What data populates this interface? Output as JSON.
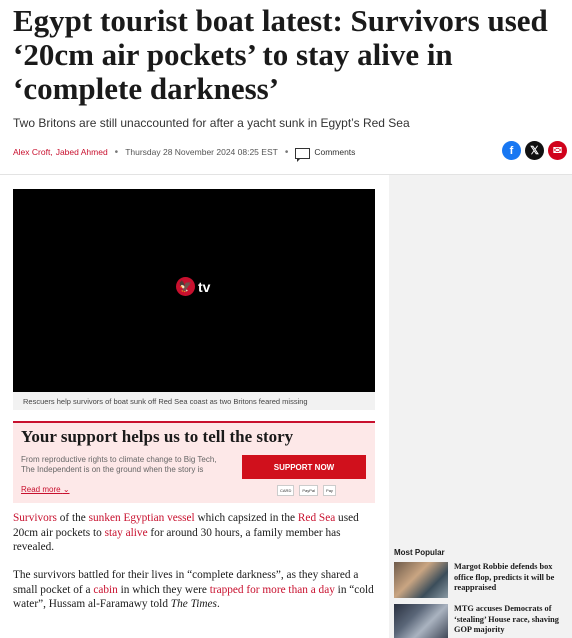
{
  "article": {
    "headline": "Egypt tourist boat latest: Survivors used ‘20cm air pockets’ to stay alive in ‘complete darkness’",
    "standfirst": "Two Britons are still unaccounted for after a yacht sunk in Egypt’s Red Sea",
    "author1": "Alex Croft,",
    "author2": "Jabed Ahmed",
    "date": "Thursday 28 November 2024 08:25 EST",
    "comments_label": "Comments"
  },
  "share": {
    "facebook_glyph": "f",
    "x_glyph": "𝕏",
    "email_glyph": "✉"
  },
  "video": {
    "logo_glyph": "🦅",
    "logo_text": "tv",
    "caption": "Rescuers help survivors of boat sunk off Red Sea coast as two Britons feared missing"
  },
  "support": {
    "title": "Your support helps us to tell the story",
    "text": "From reproductive rights to climate change to Big Tech, The Independent is on the ground when the story is developing.",
    "button": "SUPPORT NOW",
    "read_more": "Read more",
    "read_more_chevron": "⌄",
    "payments": [
      "CARD",
      "PayPal",
      "Pay"
    ]
  },
  "body": {
    "p1": {
      "l1": "Survivors",
      "t1": " of the ",
      "l2": "sunken Egyptian vessel",
      "t2": " which capsized in the ",
      "l3": "Red Sea",
      "t3": " used 20cm air pockets to ",
      "l4": "stay alive",
      "t4": " for around 30 hours, a family member has revealed."
    },
    "p2": {
      "t1": "The survivors battled for their lives in “complete darkness”, as they shared a small pocket of a ",
      "l1": "cabin",
      "t2": " in which they were ",
      "l2": "trapped for more than a day",
      "t3": " in “cold water”, Hussam al-Faramawy told ",
      "i1": "The Times",
      "t4": "."
    }
  },
  "sidebar": {
    "heading": "Most Popular",
    "items": [
      {
        "title": "Margot Robbie defends box office flop, predicts it will be reappraised"
      },
      {
        "title": "MTG accuses Democrats of ‘stealing’ House race, shaving GOP majority"
      }
    ]
  },
  "colors": {
    "accent": "#c8102e",
    "support_bg": "#fde8e8",
    "sidebar_bg": "#f2f2f2"
  }
}
